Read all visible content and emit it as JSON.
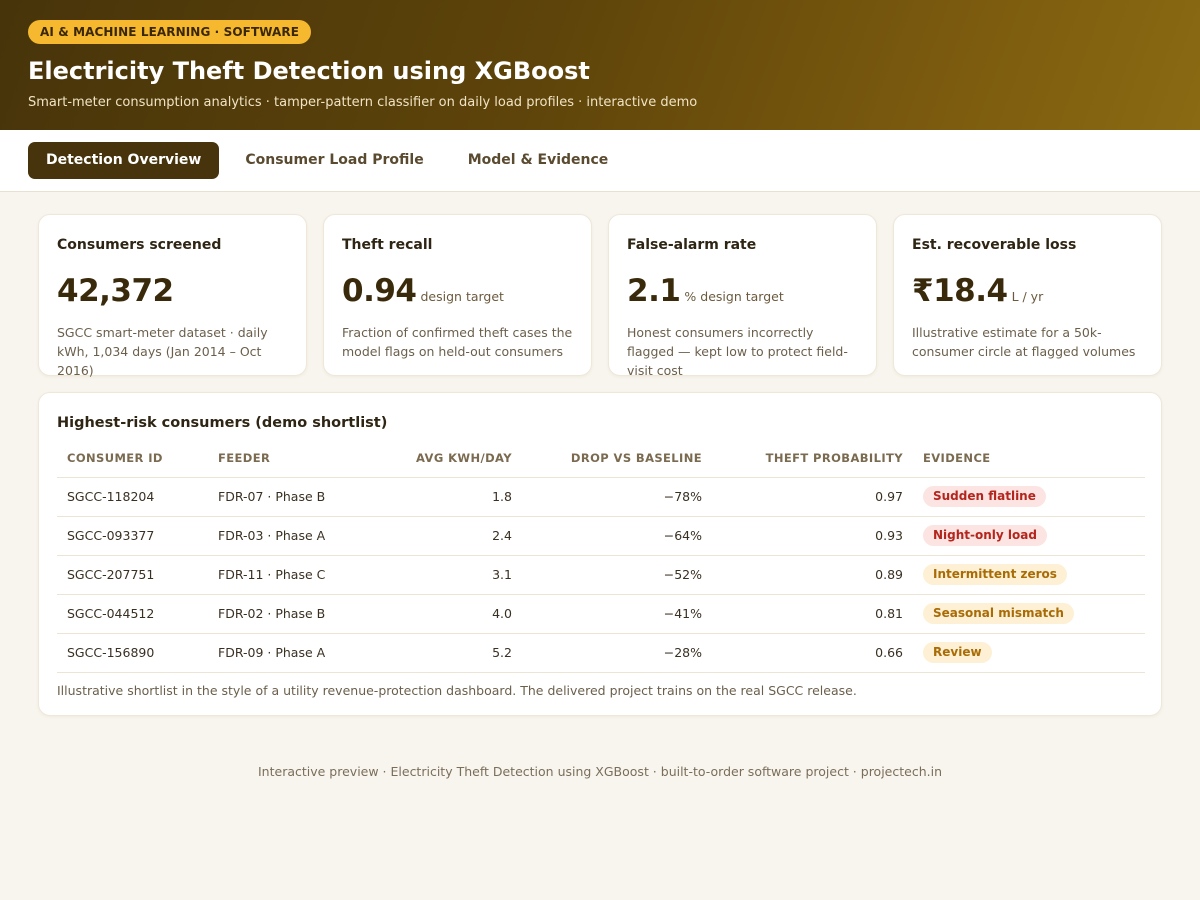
{
  "header": {
    "category_pill": "AI & MACHINE LEARNING · SOFTWARE",
    "title": "Electricity Theft Detection using XGBoost",
    "subtitle": "Smart-meter consumption analytics · tamper-pattern classifier on daily load profiles · interactive demo"
  },
  "tabs": [
    {
      "label": "Detection Overview",
      "active": true
    },
    {
      "label": "Consumer Load Profile",
      "active": false
    },
    {
      "label": "Model & Evidence",
      "active": false
    }
  ],
  "kpis": [
    {
      "title": "Consumers screened",
      "value": "42,372",
      "unit": "",
      "description": "SGCC smart-meter dataset · daily kWh, 1,034 days (Jan 2014 – Oct 2016)"
    },
    {
      "title": "Theft recall",
      "value": "0.94",
      "unit": "design target",
      "description": "Fraction of confirmed theft cases the model flags on held-out consumers"
    },
    {
      "title": "False-alarm rate",
      "value": "2.1",
      "unit": "% design target",
      "description": "Honest consumers incorrectly flagged — kept low to protect field-visit cost"
    },
    {
      "title": "Est. recoverable loss",
      "value": "₹18.4",
      "unit": "L / yr",
      "description": "Illustrative estimate for a 50k-consumer circle at flagged volumes"
    }
  ],
  "shortlist": {
    "title": "Highest-risk consumers (demo shortlist)",
    "columns": [
      "CONSUMER ID",
      "FEEDER",
      "AVG KWH/DAY",
      "DROP VS BASELINE",
      "THEFT PROBABILITY",
      "EVIDENCE"
    ],
    "rows": [
      {
        "id": "SGCC-118204",
        "feeder": "FDR-07 · Phase B",
        "avg": "1.8",
        "drop": "−78%",
        "prob": "0.97",
        "evidence": "Sudden flatline",
        "severity": "high"
      },
      {
        "id": "SGCC-093377",
        "feeder": "FDR-03 · Phase A",
        "avg": "2.4",
        "drop": "−64%",
        "prob": "0.93",
        "evidence": "Night-only load",
        "severity": "high"
      },
      {
        "id": "SGCC-207751",
        "feeder": "FDR-11 · Phase C",
        "avg": "3.1",
        "drop": "−52%",
        "prob": "0.89",
        "evidence": "Intermittent zeros",
        "severity": "med"
      },
      {
        "id": "SGCC-044512",
        "feeder": "FDR-02 · Phase B",
        "avg": "4.0",
        "drop": "−41%",
        "prob": "0.81",
        "evidence": "Seasonal mismatch",
        "severity": "med"
      },
      {
        "id": "SGCC-156890",
        "feeder": "FDR-09 · Phase A",
        "avg": "5.2",
        "drop": "−28%",
        "prob": "0.66",
        "evidence": "Review",
        "severity": "med"
      }
    ],
    "note": "Illustrative shortlist in the style of a utility revenue-protection dashboard. The delivered project trains on the real SGCC release."
  },
  "footer": {
    "text": "Interactive preview · Electricity Theft Detection using XGBoost · built-to-order software project · projectech.in"
  },
  "colors": {
    "header_gradient_start": "#47340a",
    "header_gradient_end": "#8a6a12",
    "pill_bg": "#f5b82e",
    "active_tab_bg": "#47340c",
    "page_bg": "#f8f5ee",
    "badge_high_bg": "#fbe4e1",
    "badge_high_text": "#b3261e",
    "badge_med_bg": "#fdf0d4",
    "badge_med_text": "#a86b06"
  }
}
